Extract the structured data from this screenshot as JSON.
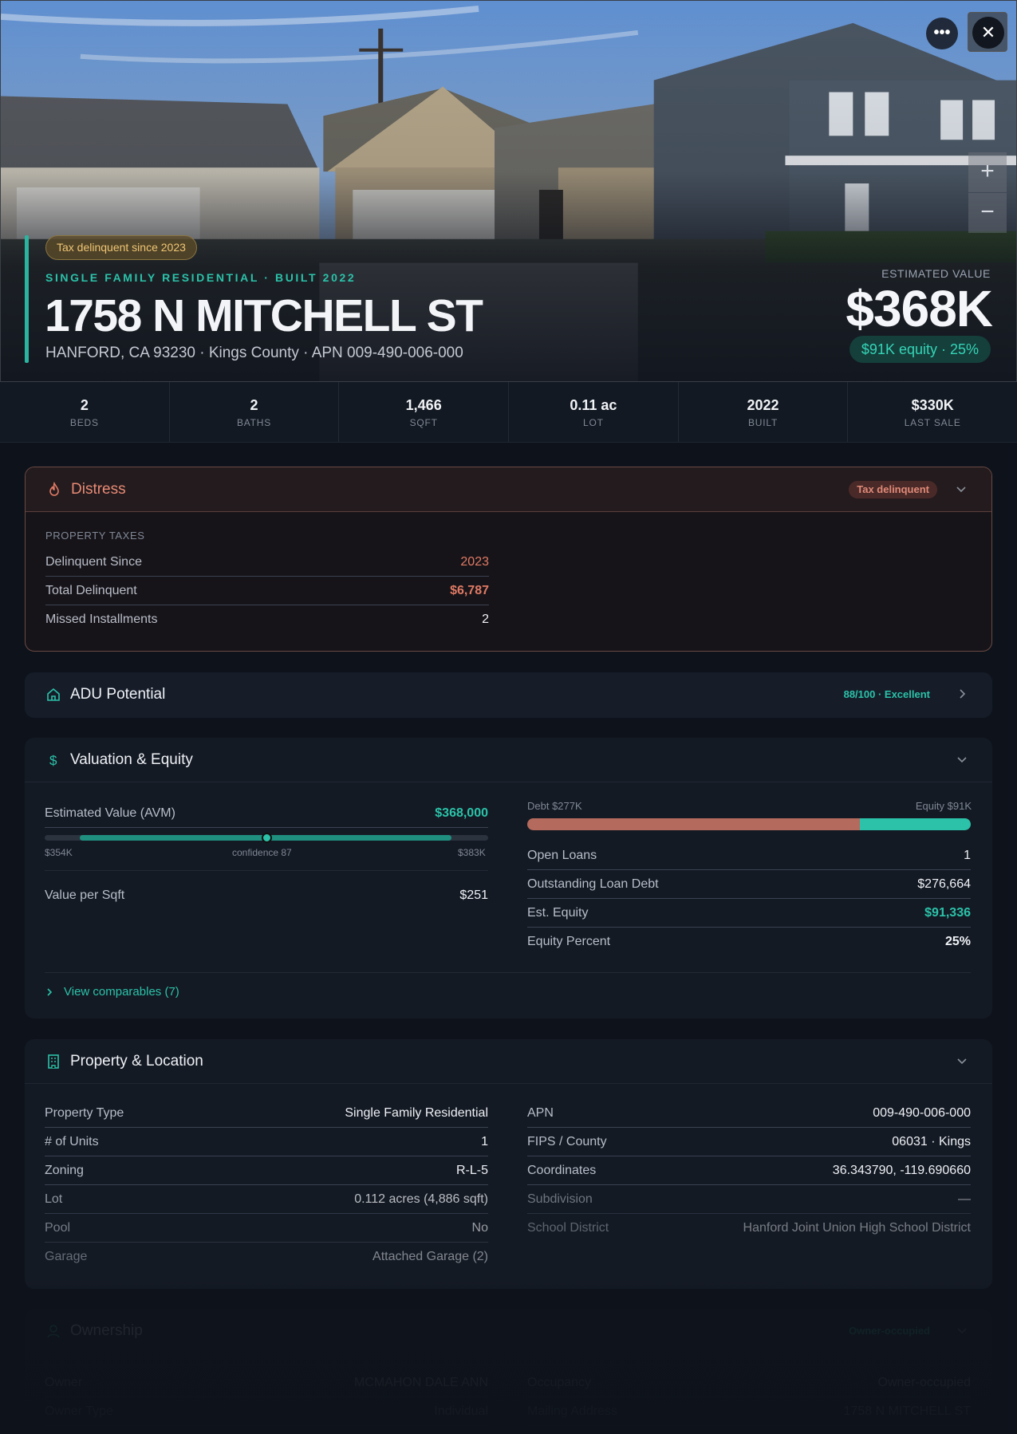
{
  "hero": {
    "tag": "Tax delinquent since 2023",
    "subtitle": "SINGLE FAMILY RESIDENTIAL · BUILT 2022",
    "address": "1758 N MITCHELL ST",
    "address_sub": "HANFORD, CA 93230 · Kings County · APN 009-490-006-000",
    "estimated_label": "ESTIMATED VALUE",
    "estimated_value": "$368K",
    "equity_pill": "$91K equity · 25%",
    "more_glyph": "•••",
    "close_glyph": "✕",
    "zoom_in": "+",
    "zoom_out": "−"
  },
  "stats": [
    {
      "value": "2",
      "label": "BEDS"
    },
    {
      "value": "2",
      "label": "BATHS"
    },
    {
      "value": "1,466",
      "label": "SQFT"
    },
    {
      "value": "0.11 ac",
      "label": "LOT"
    },
    {
      "value": "2022",
      "label": "BUILT"
    },
    {
      "value": "$330K",
      "label": "LAST SALE"
    }
  ],
  "distress": {
    "title": "Distress",
    "badge": "Tax delinquent",
    "section": "PROPERTY TAXES",
    "rows": [
      {
        "k": "Delinquent Since",
        "v": "2023"
      },
      {
        "k": "Total Delinquent",
        "v": "$6,787"
      },
      {
        "k": "Missed Installments",
        "v": "2"
      }
    ]
  },
  "adu": {
    "title": "ADU Potential",
    "badge": "88/100 · Excellent"
  },
  "valuation": {
    "title": "Valuation & Equity",
    "avm_label": "Estimated Value (AVM)",
    "avm_value": "$368,000",
    "range_low": "$354K",
    "range_mid": "confidence 87",
    "range_high": "$383K",
    "value_sqft_label": "Value per Sqft",
    "value_sqft": "$251",
    "debt_label": "Debt $277K",
    "equity_label": "Equity $91K",
    "debt_fraction": 0.75,
    "rows": [
      {
        "k": "Open Loans",
        "v": "1"
      },
      {
        "k": "Outstanding Loan Debt",
        "v": "$276,664"
      },
      {
        "k": "Est. Equity",
        "v": "$91,336"
      },
      {
        "k": "Equity Percent",
        "v": "25%"
      }
    ],
    "comparables": "View comparables (7)"
  },
  "property": {
    "title": "Property & Location",
    "left": [
      {
        "k": "Property Type",
        "v": "Single Family Residential"
      },
      {
        "k": "# of Units",
        "v": "1"
      },
      {
        "k": "Zoning",
        "v": "R-L-5"
      },
      {
        "k": "Lot",
        "v": "0.112 acres (4,886 sqft)"
      },
      {
        "k": "Pool",
        "v": "No"
      },
      {
        "k": "Garage",
        "v": "Attached Garage (2)"
      }
    ],
    "right": [
      {
        "k": "APN",
        "v": "009-490-006-000"
      },
      {
        "k": "FIPS / County",
        "v": "06031 · Kings"
      },
      {
        "k": "Coordinates",
        "v": "36.343790, -119.690660"
      },
      {
        "k": "Subdivision",
        "v": "—"
      },
      {
        "k": "School District",
        "v": "Hanford Joint Union High School District"
      }
    ]
  },
  "ownership": {
    "title": "Ownership",
    "badge": "Owner-occupied",
    "left": [
      {
        "k": "Owner",
        "v": "MCMAHON DALE ANN"
      },
      {
        "k": "Owner Type",
        "v": "Individual"
      }
    ],
    "right": [
      {
        "k": "Occupancy",
        "v": "Owner-occupied"
      },
      {
        "k": "Mailing Address",
        "v": "1758 N MITCHELL ST"
      }
    ]
  },
  "colors": {
    "accent": "#2bc2a9",
    "danger": "#e07a64",
    "warning": "#f0c674"
  }
}
